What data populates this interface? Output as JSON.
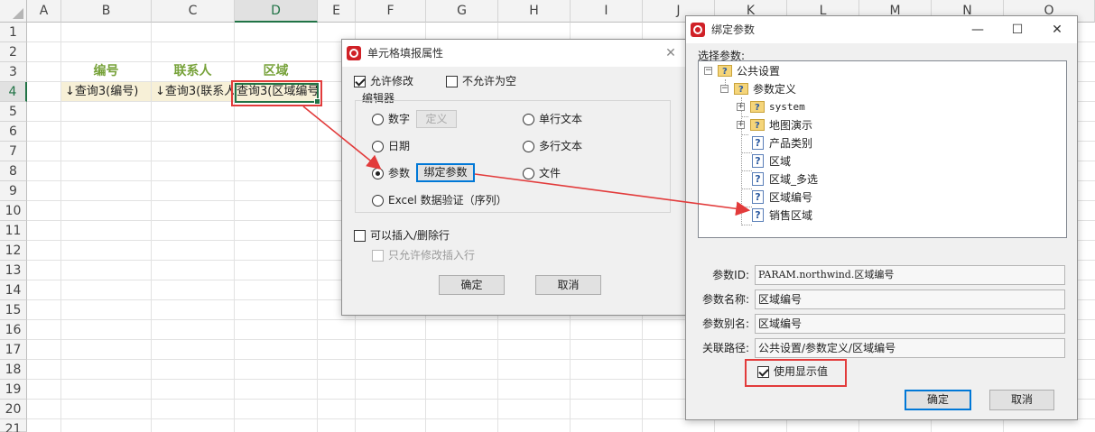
{
  "sheet": {
    "columns": [
      "A",
      "B",
      "C",
      "D",
      "E",
      "F",
      "G",
      "H",
      "I",
      "J",
      "K",
      "L",
      "M",
      "N",
      "O"
    ],
    "rows": [
      "1",
      "2",
      "3",
      "4",
      "5",
      "6",
      "7",
      "8",
      "9",
      "10",
      "11",
      "12",
      "13",
      "14",
      "15",
      "16",
      "17",
      "18",
      "19",
      "20",
      "21"
    ],
    "header_cells": {
      "b3": "编号",
      "c3": "联系人",
      "d3": "区域"
    },
    "data_cells": {
      "b4": "↓查询3(编号)",
      "c4": "↓查询3(联系人)",
      "d4": "查询3(区域编号)"
    }
  },
  "fill_dialog": {
    "title": "单元格填报属性",
    "close": "✕",
    "allow_edit": "允许修改",
    "not_null": "不允许为空",
    "editor_group": "编辑器",
    "opt_number": "数字",
    "btn_define": "定义",
    "opt_single_text": "单行文本",
    "opt_date": "日期",
    "opt_multi_text": "多行文本",
    "opt_param": "参数",
    "btn_bind_param": "绑定参数",
    "opt_file": "文件",
    "opt_excel": "Excel 数据验证（序列）",
    "insert_delete_row": "可以插入/删除行",
    "only_edit_inserted": "只允许修改插入行",
    "ok": "确定",
    "cancel": "取消"
  },
  "bind_dialog": {
    "title": "绑定参数",
    "minimize": "—",
    "maximize": "☐",
    "close": "✕",
    "choose_label": "选择参数:",
    "tree": {
      "root": "公共设置",
      "def": "参数定义",
      "system": "system",
      "map": "地图演示",
      "product": "产品类别",
      "region": "区域",
      "region_multi": "区域_多选",
      "region_code": "区域编号",
      "sales_region": "销售区域"
    },
    "param_id_label": "参数ID:",
    "param_id": "PARAM.northwind.区域编号",
    "param_name_label": "参数名称:",
    "param_name": "区域编号",
    "param_alias_label": "参数别名:",
    "param_alias": "区域编号",
    "path_label": "关联路径:",
    "path": "公共设置/参数定义/区域编号",
    "use_display": "使用显示值",
    "ok": "确定",
    "cancel": "取消"
  },
  "colors": {
    "accent_green": "#217346",
    "header_text": "#77a23a",
    "data_fill": "#f7f0d7",
    "highlight_red": "#e23b3b"
  }
}
